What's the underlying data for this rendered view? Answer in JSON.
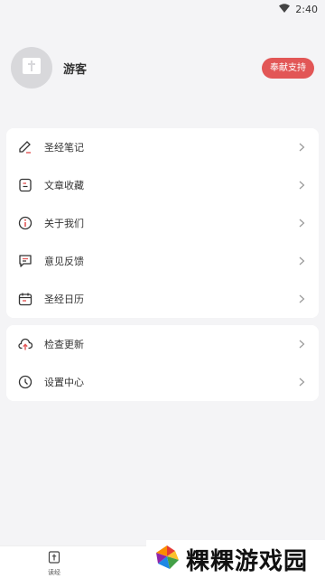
{
  "status_bar": {
    "time": "2:40",
    "wifi_icon": "wifi-icon"
  },
  "profile": {
    "username": "游客",
    "donate_label": "奉献支持"
  },
  "menu_group_1": [
    {
      "label": "圣经笔记",
      "icon": "pencil-icon"
    },
    {
      "label": "文章收藏",
      "icon": "bookmark-icon"
    },
    {
      "label": "关于我们",
      "icon": "info-icon"
    },
    {
      "label": "意见反馈",
      "icon": "chat-icon"
    },
    {
      "label": "圣经日历",
      "icon": "calendar-icon"
    }
  ],
  "menu_group_2": [
    {
      "label": "检查更新",
      "icon": "cloud-upload-icon"
    },
    {
      "label": "设置中心",
      "icon": "clock-icon"
    }
  ],
  "bottom_nav": {
    "tab_label": "读经"
  },
  "watermark": {
    "text": "粿粿游戏园"
  },
  "colors": {
    "accent": "#e25656",
    "background": "#f4f4f6"
  }
}
